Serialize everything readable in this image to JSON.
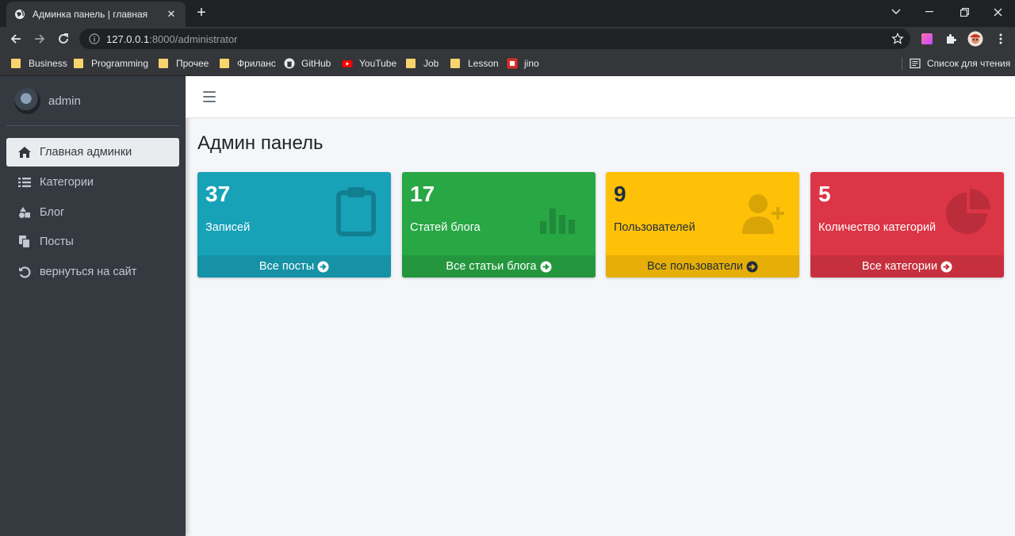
{
  "browser": {
    "tab_title": "Админка панель | главная",
    "url_host": "127.0.0.1",
    "url_rest": ":8000/administrator",
    "bookmarks": [
      {
        "label": "Business",
        "icon": "folder-icon"
      },
      {
        "label": "Programming",
        "icon": "folder-icon"
      },
      {
        "label": "Прочее",
        "icon": "folder-icon"
      },
      {
        "label": "Фриланс",
        "icon": "folder-icon"
      },
      {
        "label": "GitHub",
        "icon": "github-icon"
      },
      {
        "label": "YouTube",
        "icon": "youtube-icon"
      },
      {
        "label": "Job",
        "icon": "folder-icon"
      },
      {
        "label": "Lesson",
        "icon": "folder-icon"
      },
      {
        "label": "jino",
        "icon": "jino-icon"
      }
    ],
    "reading_list": "Список для чтения"
  },
  "sidebar": {
    "user_name": "admin",
    "items": [
      {
        "label": "Главная админки",
        "icon": "home-icon",
        "active": true
      },
      {
        "label": "Категории",
        "icon": "list-icon",
        "active": false
      },
      {
        "label": "Блог",
        "icon": "shapes-icon",
        "active": false
      },
      {
        "label": "Посты",
        "icon": "copy-icon",
        "active": false
      },
      {
        "label": "вернуться на сайт",
        "icon": "undo-icon",
        "active": false
      }
    ]
  },
  "main": {
    "title": "Админ панель",
    "cards": [
      {
        "count": "37",
        "label": "Записей",
        "link": "Все посты",
        "icon": "clipboard-icon",
        "color": "#17a2b8"
      },
      {
        "count": "17",
        "label": "Статей блога",
        "link": "Все статьи блога",
        "icon": "bar-chart-icon",
        "color": "#28a745"
      },
      {
        "count": "9",
        "label": "Пользователей",
        "link": "Все пользователи",
        "icon": "user-plus-icon",
        "color": "#ffc107"
      },
      {
        "count": "5",
        "label": "Количество категорий",
        "link": "Все категории",
        "icon": "pie-chart-icon",
        "color": "#dc3545"
      }
    ]
  }
}
